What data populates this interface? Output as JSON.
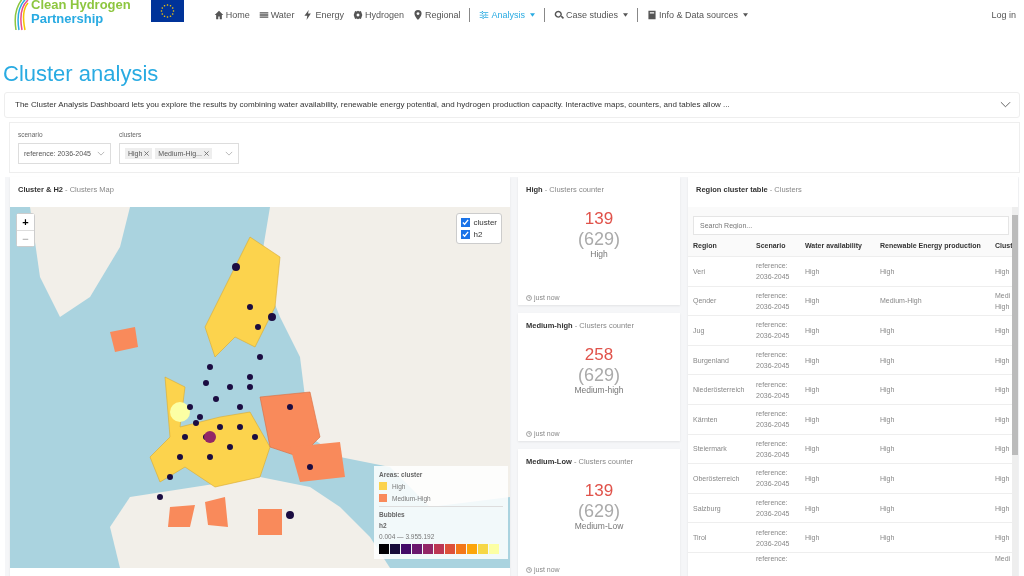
{
  "header": {
    "logo": {
      "line1": "Clean Hydrogen",
      "line2": "Partnership"
    },
    "nav": [
      {
        "label": "Home",
        "selected": false,
        "dropdown": false
      },
      {
        "label": "Water",
        "selected": false,
        "dropdown": false
      },
      {
        "label": "Energy",
        "selected": false,
        "dropdown": false
      },
      {
        "label": "Hydrogen",
        "selected": false,
        "dropdown": false
      },
      {
        "label": "Regional",
        "selected": false,
        "dropdown": false
      },
      {
        "label": "Analysis",
        "selected": true,
        "dropdown": true
      },
      {
        "label": "Case studies",
        "selected": false,
        "dropdown": true
      },
      {
        "label": "Info & Data sources",
        "selected": false,
        "dropdown": true
      }
    ],
    "login": "Log in"
  },
  "title": "Cluster analysis",
  "description": "The Cluster Analysis Dashboard lets you explore the results by combining water availability, renewable energy potential, and hydrogen production capacity. Interactive maps, counters, and tables allow ...",
  "filters": {
    "scenario": {
      "label": "scenario",
      "value": "reference: 2036-2045"
    },
    "clusters": {
      "label": "clusters",
      "tags": [
        "High",
        "Medium-Hig..."
      ]
    }
  },
  "map_panel": {
    "title": "Cluster & H2",
    "subtitle": "- Clusters Map",
    "zoom_in": "+",
    "zoom_out": "−",
    "layers": [
      {
        "label": "cluster",
        "checked": true
      },
      {
        "label": "h2",
        "checked": true
      }
    ],
    "legend": {
      "areas_title": "Areas: cluster",
      "areas": [
        {
          "label": "High",
          "color": "#fcd34d"
        },
        {
          "label": "Medium-High",
          "color": "#f98a5b"
        }
      ],
      "bubbles_title": "Bubbles",
      "bubbles_var": "h2",
      "range": "0.004 — 3.955.192"
    }
  },
  "counters": [
    {
      "title": "High",
      "subtitle": "- Clusters counter",
      "value": "139",
      "total": "(629)",
      "label": "High",
      "time": "just now"
    },
    {
      "title": "Medium-high",
      "subtitle": "- Clusters counter",
      "value": "258",
      "total": "(629)",
      "label": "Medium-high",
      "time": "just now"
    },
    {
      "title": "Medium-Low",
      "subtitle": "- Clusters counter",
      "value": "139",
      "total": "(629)",
      "label": "Medium-Low",
      "time": "just now"
    }
  ],
  "table_panel": {
    "title": "Region cluster table",
    "subtitle": "- Clusters",
    "search": {
      "placeholder": "Search Region..."
    },
    "columns": [
      "Region",
      "Scenario",
      "Water availability",
      "Renewable Energy production",
      "Clust"
    ],
    "rows": [
      {
        "region": "Veri",
        "scenario": "reference: 2036-2045",
        "water": "High",
        "renewable": "High",
        "cluster": "High"
      },
      {
        "region": "Qender",
        "scenario": "reference: 2036-2045",
        "water": "High",
        "renewable": "Medium-High",
        "cluster": "Medi High"
      },
      {
        "region": "Jug",
        "scenario": "reference: 2036-2045",
        "water": "High",
        "renewable": "High",
        "cluster": "High"
      },
      {
        "region": "Burgenland",
        "scenario": "reference: 2036-2045",
        "water": "High",
        "renewable": "High",
        "cluster": "High"
      },
      {
        "region": "Niederösterreich",
        "scenario": "reference: 2036-2045",
        "water": "High",
        "renewable": "High",
        "cluster": "High"
      },
      {
        "region": "Kärnten",
        "scenario": "reference: 2036-2045",
        "water": "High",
        "renewable": "High",
        "cluster": "High"
      },
      {
        "region": "Steiermark",
        "scenario": "reference: 2036-2045",
        "water": "High",
        "renewable": "High",
        "cluster": "High"
      },
      {
        "region": "Oberösterreich",
        "scenario": "reference: 2036-2045",
        "water": "High",
        "renewable": "High",
        "cluster": "High"
      },
      {
        "region": "Salzburg",
        "scenario": "reference: 2036-2045",
        "water": "High",
        "renewable": "High",
        "cluster": "High"
      },
      {
        "region": "Tirol",
        "scenario": "reference: 2036-2045",
        "water": "High",
        "renewable": "High",
        "cluster": "High"
      },
      {
        "scenario": "reference:",
        "cluster": "Medi"
      }
    ]
  }
}
